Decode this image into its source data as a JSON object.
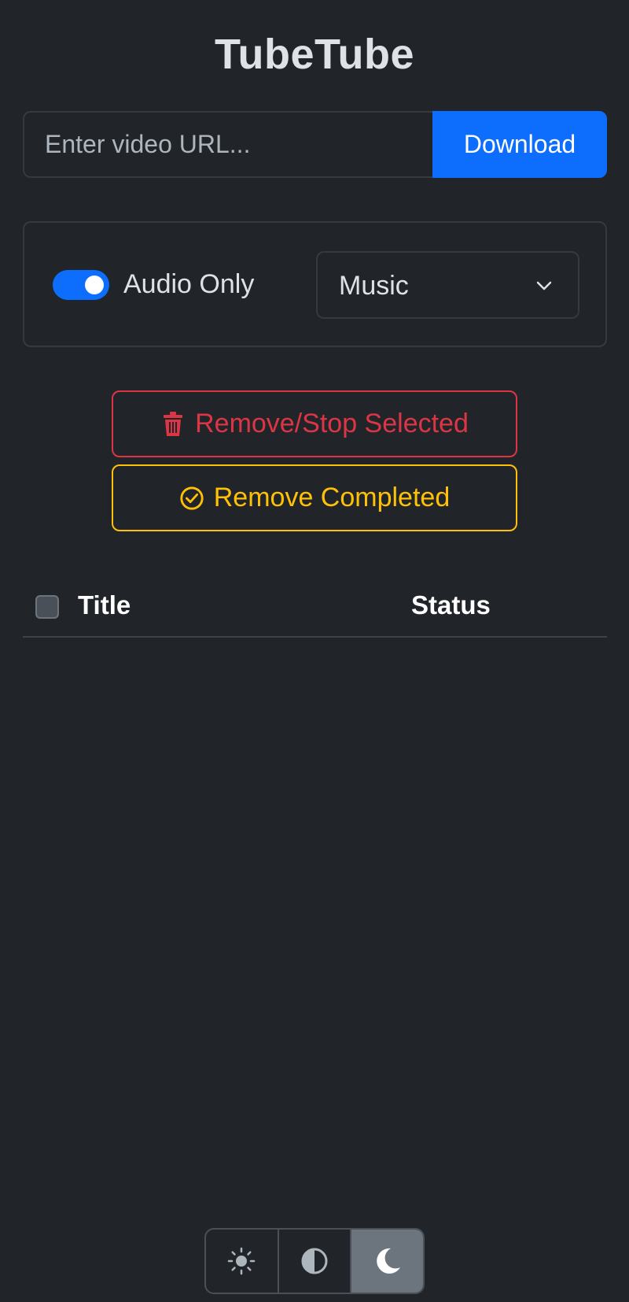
{
  "app": {
    "title": "TubeTube"
  },
  "url_bar": {
    "placeholder": "Enter video URL...",
    "value": "",
    "download_label": "Download"
  },
  "options": {
    "audio_only": {
      "label": "Audio Only",
      "checked": true
    },
    "category_select": {
      "selected": "Music"
    }
  },
  "actions": {
    "remove_stop_label": "Remove/Stop Selected",
    "remove_completed_label": "Remove Completed"
  },
  "table": {
    "columns": [
      "Title",
      "Status"
    ],
    "rows": []
  },
  "theme_switcher": {
    "options": [
      "light",
      "auto",
      "dark"
    ],
    "active": "dark"
  },
  "colors": {
    "background": "#212529",
    "primary": "#0d6efd",
    "danger": "#dc3545",
    "warning": "#ffc107"
  }
}
